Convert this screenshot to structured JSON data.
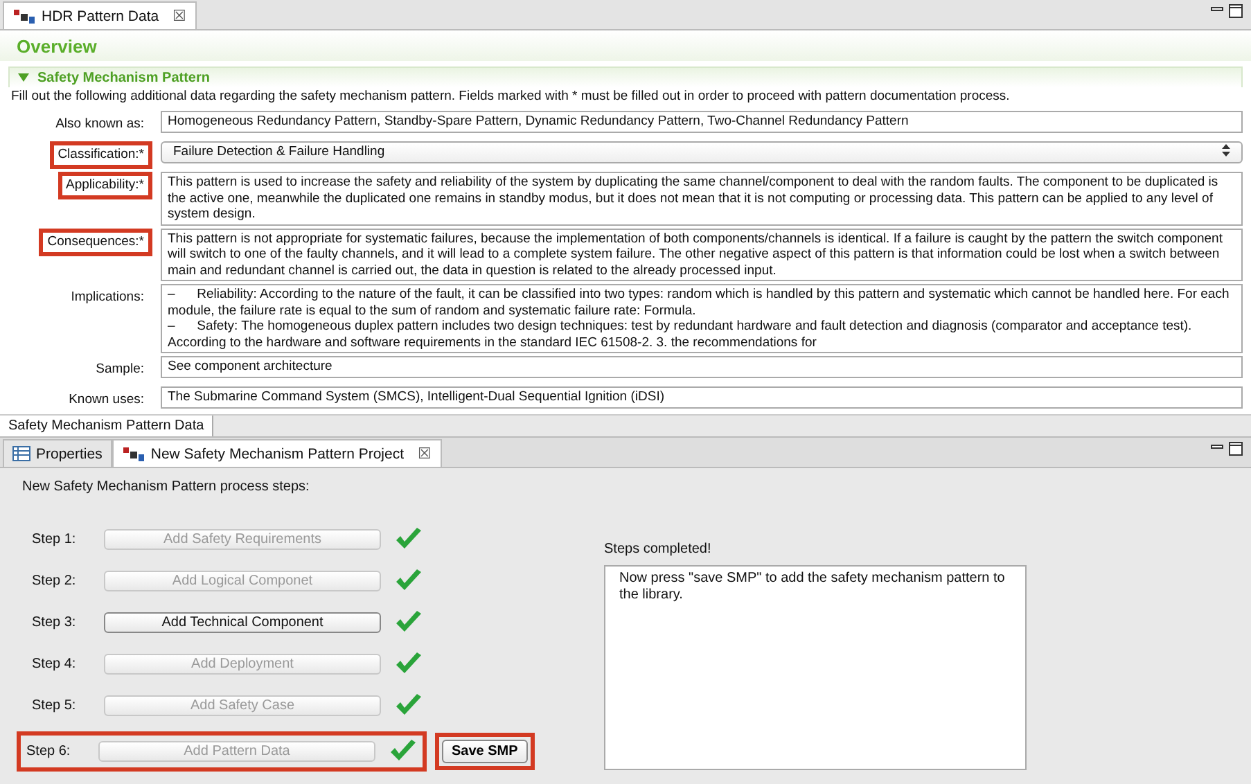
{
  "editor_tab": {
    "title": "HDR Pattern Data",
    "close": "☒"
  },
  "overview_title": "Overview",
  "section": {
    "title": "Safety Mechanism Pattern",
    "expanded": true,
    "description": "Fill out the following additional data regarding the safety mechanism pattern. Fields marked with * must be filled out in order to proceed with pattern documentation process.",
    "fields": [
      {
        "label": "Also known as:",
        "kind": "text",
        "highlighted": false,
        "value": "Homogeneous Redundancy Pattern, Standby-Spare Pattern, Dynamic Redundancy Pattern, Two-Channel Redundancy Pattern"
      },
      {
        "label": "Classification:*",
        "kind": "select",
        "highlighted": true,
        "value": "Failure Detection & Failure Handling"
      },
      {
        "label": "Applicability:*",
        "kind": "area",
        "highlighted": true,
        "value": "This pattern is used to increase the safety and reliability of the system by duplicating the same channel/component to deal with the random faults. The component to be duplicated is the active one, meanwhile the duplicated one remains in standby modus, but it does not mean that it is not computing or processing data. This pattern can be applied to any level of system design."
      },
      {
        "label": "Consequences:*",
        "kind": "area",
        "highlighted": true,
        "value": "This pattern is not appropriate for systematic failures, because the implementation of both components/channels is identical. If a failure is caught by the pattern the switch component will switch to one of the faulty channels, and it will lead to a complete system failure. The other negative aspect of this pattern is that information could be lost when a switch between main and redundant channel is carried out, the data in question is related to the already processed input."
      },
      {
        "label": "Implications:",
        "kind": "area",
        "highlighted": false,
        "value": "–      Reliability: According to the nature of the fault, it can be classified into two types: random which is handled by this pattern and systematic which cannot be handled here. For each module, the failure rate is equal to the sum of random and systematic failure rate: Formula.\n–      Safety: The homogeneous duplex pattern includes two design techniques: test by redundant hardware and fault detection and diagnosis (comparator and acceptance test). According to the hardware and software requirements in the standard IEC 61508-2. 3. the recommendations for"
      },
      {
        "label": "Sample:",
        "kind": "text",
        "highlighted": false,
        "value": "See component architecture"
      },
      {
        "label": "Known uses:",
        "kind": "text",
        "highlighted": false,
        "value": "The Submarine Command System (SMCS), Intelligent-Dual Sequential Ignition (iDSI)"
      }
    ]
  },
  "page_tab": {
    "label": "Safety Mechanism Pattern Data",
    "selected": true
  },
  "view_tabs": [
    {
      "label": "Properties",
      "selected": false
    },
    {
      "label": "New Safety Mechanism Pattern Project",
      "selected": true,
      "close": "☒"
    }
  ],
  "process": {
    "heading": "New Safety Mechanism Pattern process steps:",
    "steps": [
      {
        "label": "Step 1:",
        "button": "Add Safety Requirements",
        "disabled": true,
        "done": true,
        "highlighted": false
      },
      {
        "label": "Step 2:",
        "button": "Add Logical Componet",
        "disabled": true,
        "done": true,
        "highlighted": false
      },
      {
        "label": "Step 3:",
        "button": "Add Technical Component",
        "disabled": false,
        "done": true,
        "highlighted": false
      },
      {
        "label": "Step 4:",
        "button": "Add Deployment",
        "disabled": true,
        "done": true,
        "highlighted": false
      },
      {
        "label": "Step 5:",
        "button": "Add Safety Case",
        "disabled": true,
        "done": true,
        "highlighted": false
      },
      {
        "label": "Step 6:",
        "button": "Add Pattern Data",
        "disabled": true,
        "done": true,
        "highlighted": true
      }
    ],
    "save_button": {
      "label": "Save SMP",
      "highlighted": true
    },
    "status_label": "Steps completed!",
    "message": "Now press \"save SMP\" to add the safety mechanism pattern to the library."
  }
}
